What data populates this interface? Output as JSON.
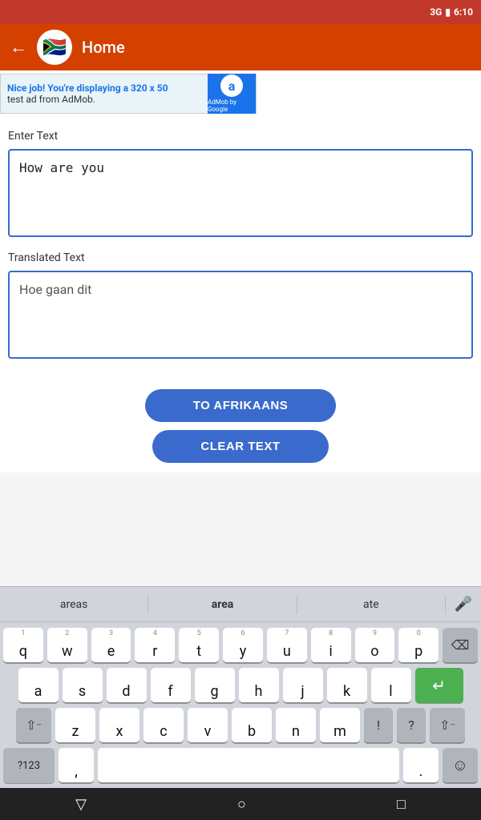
{
  "statusBar": {
    "signal": "3G",
    "time": "6:10",
    "battery": "🔋"
  },
  "topBar": {
    "back": "←",
    "title": "Home",
    "flag": "🇿🇦"
  },
  "ad": {
    "line1_bold": "Nice job!",
    "line1_rest": " You're displaying a 320 x 50",
    "line2": "test ad from AdMob.",
    "logo_letter": "a",
    "by": "AdMob by Google"
  },
  "enterTextLabel": "Enter Text",
  "inputText": "How are you",
  "translatedTextLabel": "Translated Text",
  "translatedText": "Hoe gaan dit",
  "buttons": {
    "toAfrikaans": "TO AFRIKAANS",
    "clearText": "CLEAR TEXT"
  },
  "keyboard": {
    "suggestions": [
      "areas",
      "area",
      "ate"
    ],
    "row1": [
      "q",
      "w",
      "e",
      "r",
      "t",
      "y",
      "u",
      "i",
      "o",
      "p"
    ],
    "row1nums": [
      "1",
      "2",
      "3",
      "4",
      "5",
      "6",
      "7",
      "8",
      "9",
      "0"
    ],
    "row2": [
      "a",
      "s",
      "d",
      "f",
      "g",
      "h",
      "j",
      "k",
      "l"
    ],
    "row3": [
      "z",
      "x",
      "c",
      "v",
      "b",
      "n",
      "m"
    ],
    "bottomLeft": "?123",
    "comma": ",",
    "period": ".",
    "emoji": "☺"
  },
  "navBar": {
    "back": "▽",
    "home": "○",
    "recent": "□"
  }
}
